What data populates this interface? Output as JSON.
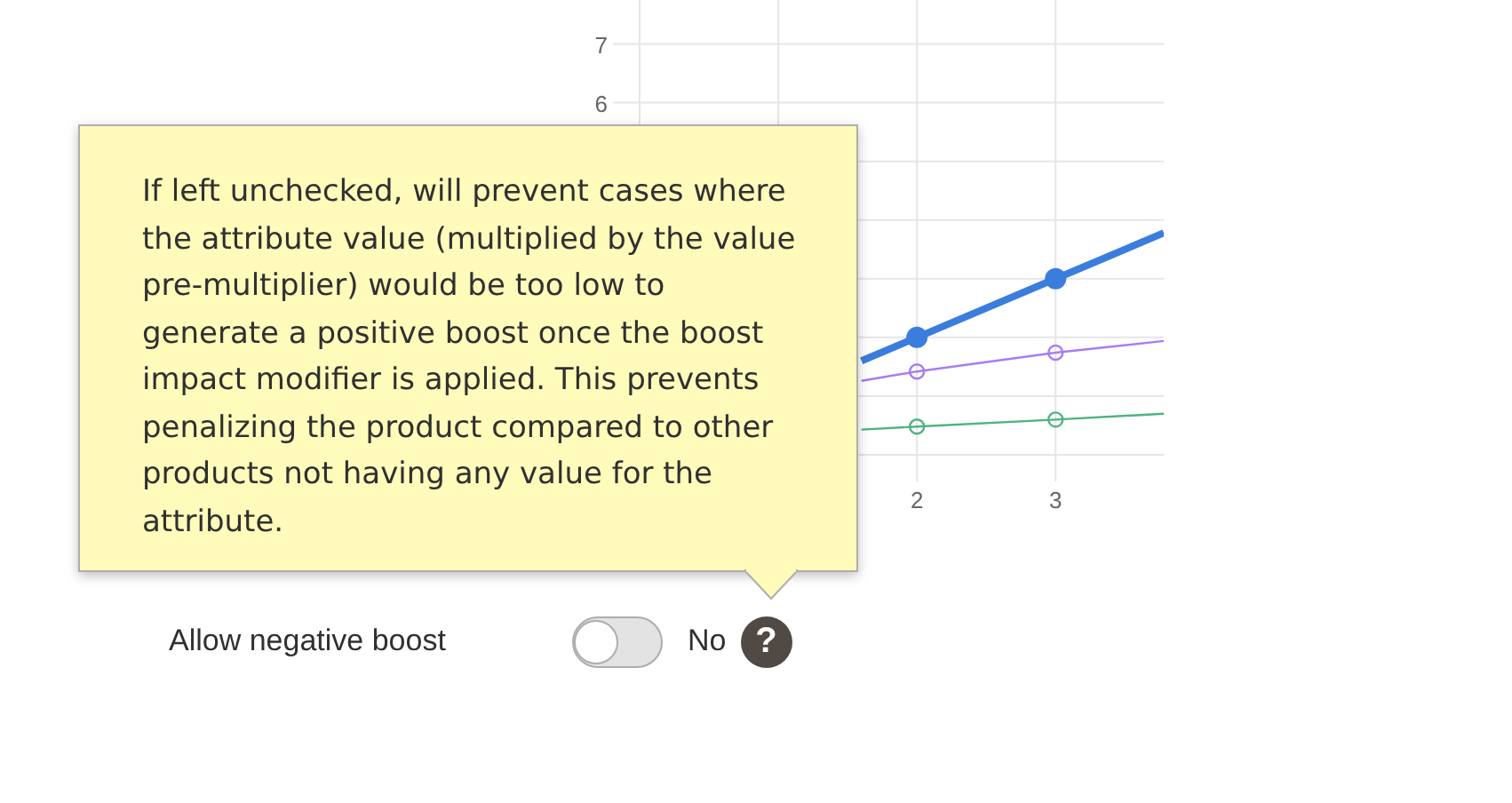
{
  "chart": {
    "chart_data": {
      "type": "line",
      "grid": true,
      "x": [
        1.6,
        2,
        3,
        3.78
      ],
      "xlim": [
        0,
        3.78
      ],
      "ylim": [
        0,
        7.75
      ],
      "xticks": [
        2,
        3
      ],
      "yticks": [
        6,
        7
      ],
      "series": [
        {
          "color": "#3b7ddd",
          "marker": "circle",
          "values": [
            1.6,
            2,
            3,
            3.78
          ]
        },
        {
          "color": "#a77cf4",
          "marker": "circle",
          "values": [
            1.26,
            1.42,
            1.74,
            1.94
          ]
        },
        {
          "color": "#4fb381",
          "marker": "circle",
          "values": [
            0.43,
            0.48,
            0.6,
            0.7
          ]
        }
      ]
    }
  },
  "tooltip": {
    "text": "If left unchecked, will prevent cases where the attribute value (multiplied by the value pre-multiplier) would be too low to generate a positive boost once the boost impact modifier is applied. This prevents penalizing the product compared to other products not having any value for the attribute."
  },
  "field": {
    "label": "Allow negative boost",
    "toggle": {
      "on": false
    },
    "value": "No",
    "help_icon": "?"
  }
}
